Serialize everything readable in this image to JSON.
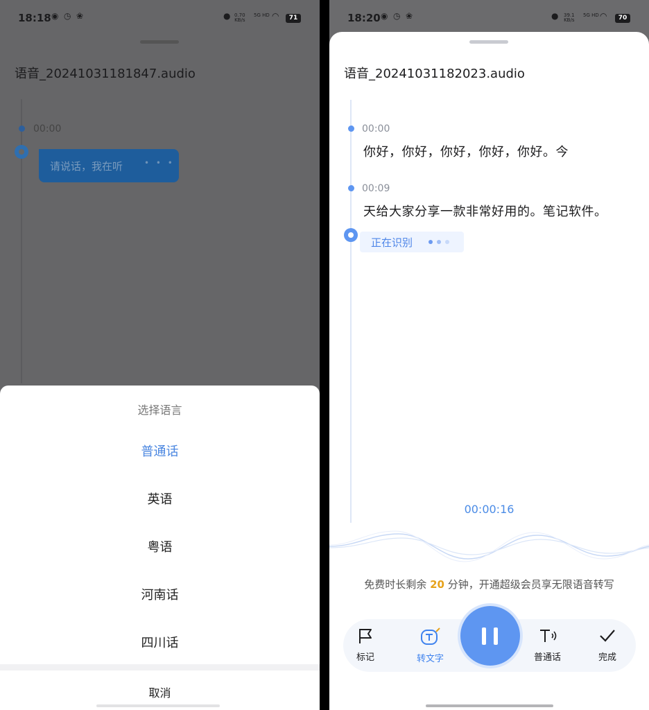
{
  "left": {
    "status": {
      "time": "18:18",
      "net_speed": "0.70",
      "net_unit": "KB/s",
      "net_type": "5G HD",
      "battery": "71"
    },
    "file_name": "语音_20241031181847.audio",
    "timeline": [
      {
        "time": "00:00"
      }
    ],
    "listening_bubble": "请说话，我在听",
    "sheet": {
      "title": "选择语言",
      "options": [
        "普通话",
        "英语",
        "粤语",
        "河南话",
        "四川话"
      ],
      "selected": "普通话",
      "cancel": "取消"
    }
  },
  "right": {
    "status": {
      "time": "18:20",
      "net_speed": "39.1",
      "net_unit": "KB/s",
      "net_type": "5G HD",
      "battery": "70"
    },
    "file_name": "语音_20241031182023.audio",
    "transcript": [
      {
        "time": "00:00",
        "text": "你好，你好，你好，你好，你好。今"
      },
      {
        "time": "00:09",
        "text": "天给大家分享一款非常好用的。笔记软件。"
      }
    ],
    "recognizing": "正在识别",
    "timer": "00:00:16",
    "quota": {
      "prefix": "免费时长剩余 ",
      "minutes": "20",
      "suffix": " 分钟，开通超级会员享无限语音转写"
    },
    "toolbar": {
      "mark": "标记",
      "transcribe": "转文字",
      "language": "普通话",
      "done": "完成"
    }
  },
  "colors": {
    "accent": "#5e96f1",
    "timer": "#4a8be6",
    "highlight": "#e6a21b"
  }
}
